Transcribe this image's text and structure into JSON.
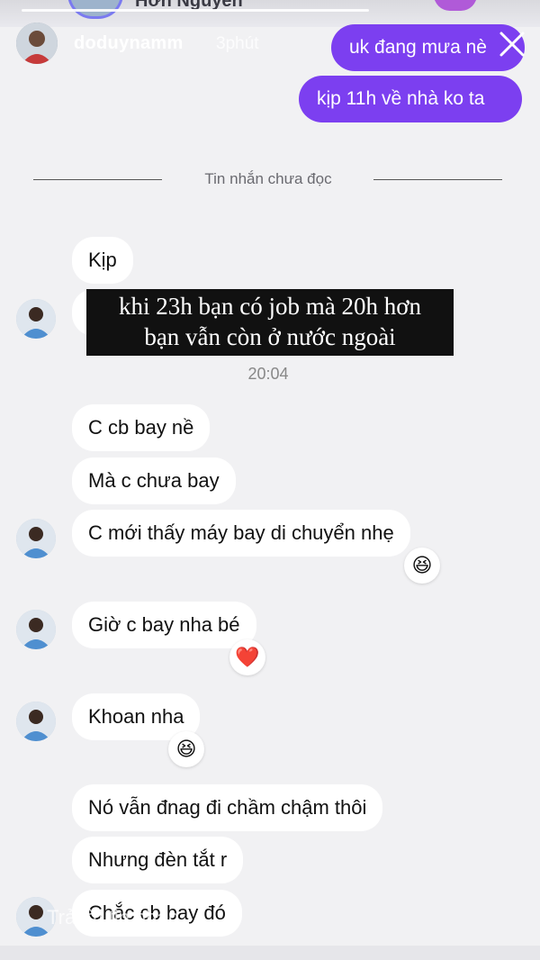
{
  "story": {
    "top_name_fragment": "Hơn Nguyễn",
    "poster_name": "doduynamm",
    "time_ago": "3phút"
  },
  "outgoing": [
    {
      "text": "uk đang mưa nè"
    },
    {
      "text": "kịp 11h về nhà ko ta"
    }
  ],
  "divider_label": "Tin nhắn chưa đọc",
  "caption_lines": [
    "khi 23h bạn có job mà 20h hơn",
    "bạn vẫn còn ở nước ngoài"
  ],
  "timestamp": "20:04",
  "messages": {
    "m1": "Kịp",
    "m2": "C cb bay nề",
    "m3": "Mà c chưa bay",
    "m4": "C mới thấy máy bay di chuyển nhẹ",
    "m5": "Giờ c bay nha bé",
    "m6": "Khoan nha",
    "m7": "Nó vẫn đnag đi chầm chậm thôi",
    "m8": "Nhưng đèn tắt r",
    "m9": "Chắc cb bay đó"
  },
  "reactions": {
    "r1": "😆",
    "r2": "❤️",
    "r3": "😆"
  },
  "overlay_text": "Trả lời tin nhắn",
  "colors": {
    "outgoing_bubble": "#7c3ff0",
    "background": "#f1f1f3"
  }
}
